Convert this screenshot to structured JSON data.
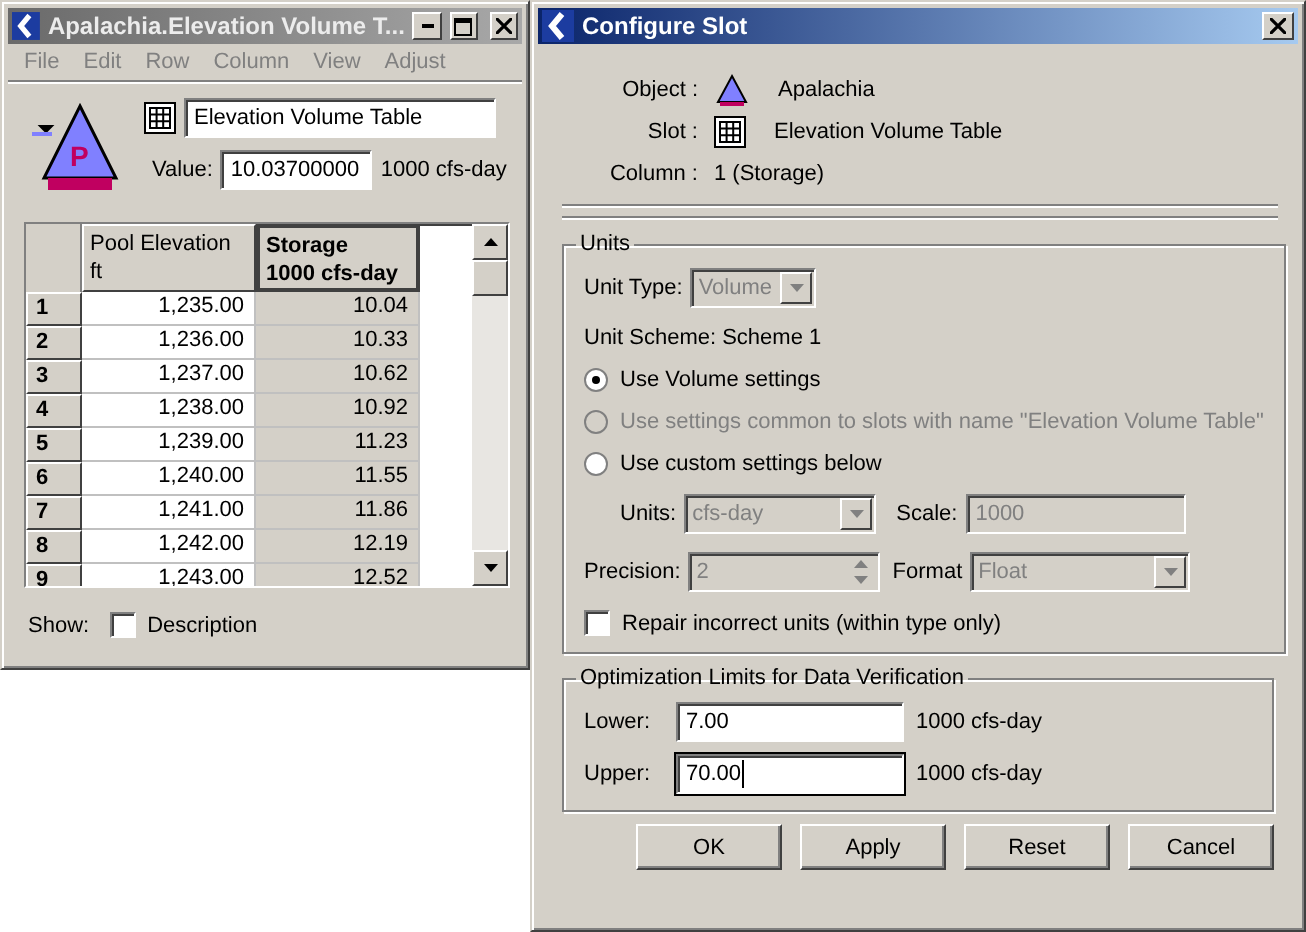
{
  "table_window": {
    "title": "Apalachia.Elevation Volume T...",
    "active": false,
    "menu": [
      "File",
      "Edit",
      "Row",
      "Column",
      "View",
      "Adjust"
    ],
    "icon_letter": "P",
    "slot_name": "Elevation Volume Table",
    "value_label": "Value:",
    "value": "10.03700000",
    "value_unit": "1000 cfs-day",
    "columns": [
      {
        "name": "Pool Elevation",
        "unit": "ft",
        "selected": false
      },
      {
        "name": "Storage",
        "unit": "1000 cfs-day",
        "selected": true
      }
    ],
    "rows": [
      {
        "index": "1",
        "cells": [
          "1,235.00",
          "10.04"
        ]
      },
      {
        "index": "2",
        "cells": [
          "1,236.00",
          "10.33"
        ]
      },
      {
        "index": "3",
        "cells": [
          "1,237.00",
          "10.62"
        ]
      },
      {
        "index": "4",
        "cells": [
          "1,238.00",
          "10.92"
        ]
      },
      {
        "index": "5",
        "cells": [
          "1,239.00",
          "11.23"
        ]
      },
      {
        "index": "6",
        "cells": [
          "1,240.00",
          "11.55"
        ]
      },
      {
        "index": "7",
        "cells": [
          "1,241.00",
          "11.86"
        ]
      },
      {
        "index": "8",
        "cells": [
          "1,242.00",
          "12.19"
        ]
      },
      {
        "index": "9",
        "cells": [
          "1,243.00",
          "12.52"
        ]
      }
    ],
    "show_label": "Show:",
    "show_option": {
      "label": "Description",
      "checked": false
    }
  },
  "dialog": {
    "title": "Configure Slot",
    "active": true,
    "info": [
      {
        "kind": "reservoir",
        "label": "Object :",
        "value": "Apalachia"
      },
      {
        "kind": "table",
        "label": "Slot :",
        "value": "Elevation Volume Table"
      },
      {
        "kind": "text",
        "label": "Column :",
        "value": "1 (Storage)"
      }
    ],
    "units": {
      "title": "Units",
      "unit_type_label": "Unit Type:",
      "unit_type": "Volume",
      "unit_type_disabled": true,
      "scheme": "Unit Scheme: Scheme 1",
      "options": [
        {
          "label": "Use Volume settings",
          "selected": true,
          "disabled": false
        },
        {
          "label": "Use settings common to slots with name \"Elevation Volume Table\"",
          "selected": false,
          "disabled": true
        },
        {
          "label": "Use custom settings below",
          "selected": false,
          "disabled": false
        }
      ],
      "custom_disabled": true,
      "units_label": "Units:",
      "units_value": "cfs-day",
      "scale_label": "Scale:",
      "scale_value": "1000",
      "precision_label": "Precision:",
      "precision_value": "2",
      "format_label": "Format",
      "format_value": "Float",
      "repair": {
        "label": "Repair incorrect units (within type only)",
        "checked": false
      }
    },
    "limits": {
      "title": "Optimization Limits for Data Verification",
      "rows": [
        {
          "label": "Lower:",
          "value": "7.00",
          "unit": "1000 cfs-day",
          "focused": false
        },
        {
          "label": "Upper:",
          "value": "70.00",
          "unit": "1000 cfs-day",
          "focused": true
        }
      ]
    },
    "buttons": [
      "OK",
      "Apply",
      "Reset",
      "Cancel"
    ]
  }
}
